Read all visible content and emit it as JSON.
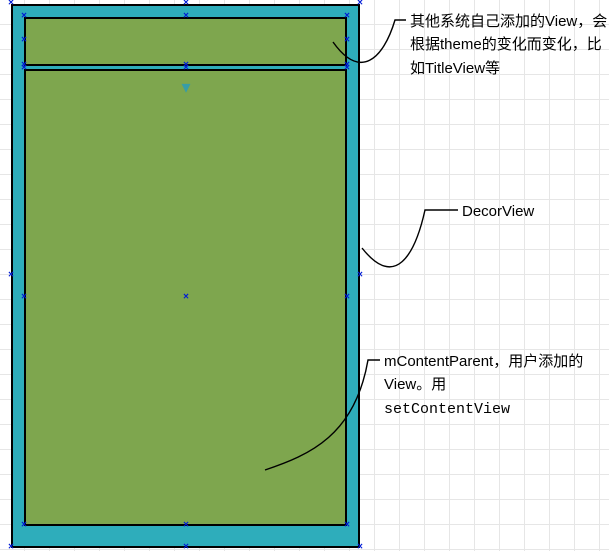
{
  "annotations": {
    "title_view": "其他系统自己添加的View，会根据theme的变化而变化，比如TitleView等",
    "decor_view": "DecorView",
    "content_parent_line1": "mContentParent，用户添加的View。用",
    "content_parent_code": "setContentView"
  },
  "shapes": {
    "decor": {
      "name": "DecorView"
    },
    "title": {
      "name": "TitleView"
    },
    "content": {
      "name": "mContentParent"
    }
  }
}
